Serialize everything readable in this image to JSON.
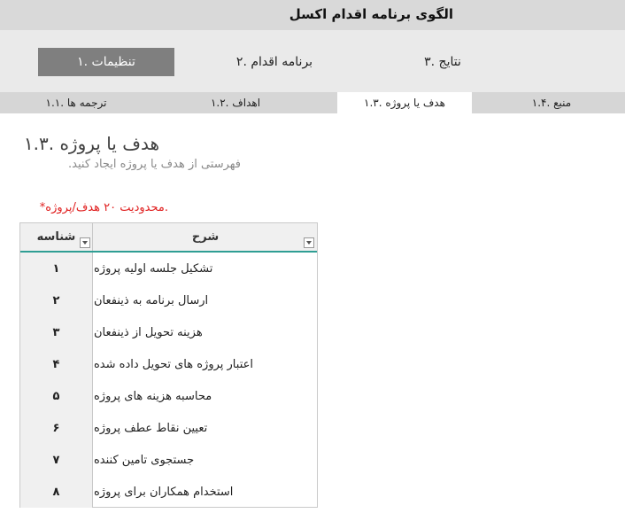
{
  "app": {
    "title": "الگوی برنامه اقدام اکسل"
  },
  "main_nav": [
    {
      "label": "تنظیمات .۱",
      "active": true
    },
    {
      "label": "برنامه اقدام .۲",
      "active": false
    },
    {
      "label": "نتایج .۳",
      "active": false
    }
  ],
  "sub_nav": [
    {
      "label": "ترجمه ها .۱.۱",
      "active": false
    },
    {
      "label": "اهداف .۱.۲",
      "active": false
    },
    {
      "label": "هدف  یا پروژه .۱.۳",
      "active": true
    },
    {
      "label": "منبع .۱.۴",
      "active": false
    }
  ],
  "page": {
    "title": "هدف یا پروژه .۱.۳",
    "subtitle": "فهرستی از هدف یا پروژه ایجاد کنید.",
    "note": ".محدودیت ۲۰ هدف/پروژه*"
  },
  "table": {
    "columns": {
      "description": "شرح",
      "id": "شناسه"
    },
    "rows": [
      {
        "id": "۱",
        "description": "تشکیل جلسه اولیه پروژه"
      },
      {
        "id": "۲",
        "description": "ارسال برنامه به ذینفعان"
      },
      {
        "id": "۳",
        "description": "هزینه تحویل از ذینفعان"
      },
      {
        "id": "۴",
        "description": "اعتبار پروژه های تحویل داده شده"
      },
      {
        "id": "۵",
        "description": "محاسبه هزینه های پروژه"
      },
      {
        "id": "۶",
        "description": "تعیین نقاط عطف پروژه"
      },
      {
        "id": "۷",
        "description": "جستجوی تامین کننده"
      },
      {
        "id": "۸",
        "description": "استخدام همکاران برای پروژه"
      }
    ]
  },
  "colors": {
    "accent_line": "#2f9e94",
    "active_tab": "#7f7f7f",
    "note": "#e02020"
  },
  "icons": {
    "filter": "dropdown-arrow-icon"
  }
}
